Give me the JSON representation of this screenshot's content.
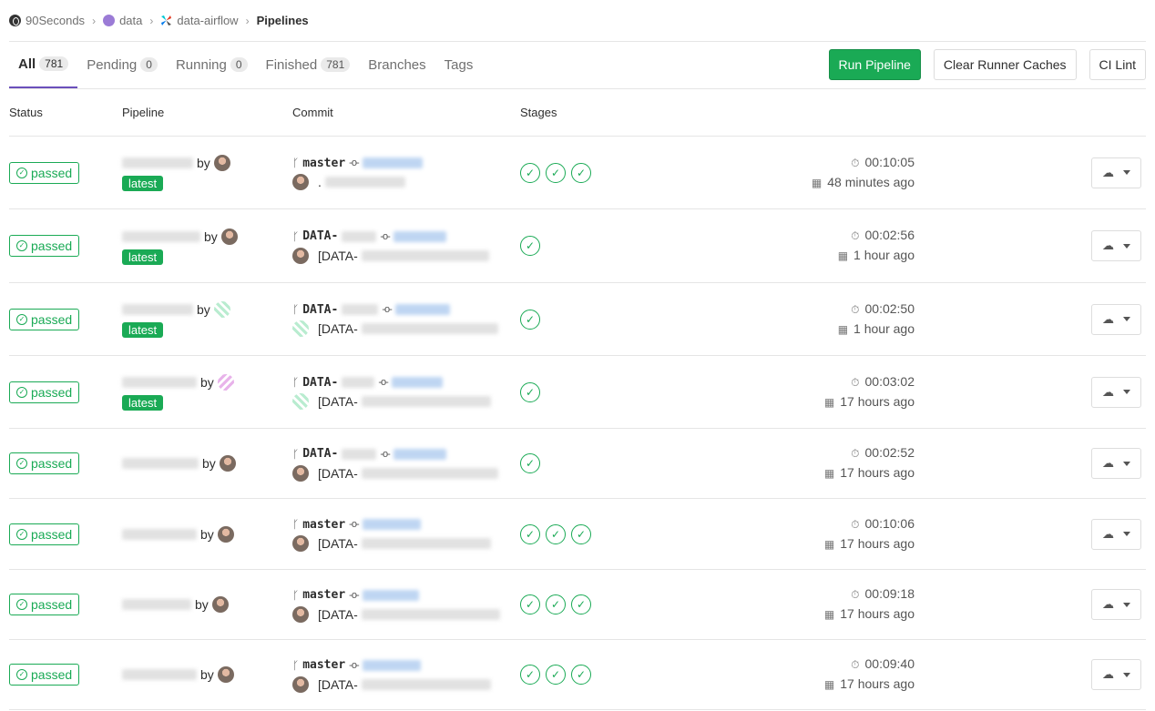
{
  "breadcrumb": {
    "org": "90Seconds",
    "group": "data",
    "project": "data-airflow",
    "current": "Pipelines"
  },
  "tabs": [
    {
      "label": "All",
      "count": "781",
      "active": true
    },
    {
      "label": "Pending",
      "count": "0"
    },
    {
      "label": "Running",
      "count": "0"
    },
    {
      "label": "Finished",
      "count": "781"
    },
    {
      "label": "Branches"
    },
    {
      "label": "Tags"
    }
  ],
  "actions": {
    "run_pipeline": "Run Pipeline",
    "clear_caches": "Clear Runner Caches",
    "ci_lint": "CI Lint"
  },
  "table_headers": {
    "status": "Status",
    "pipeline": "Pipeline",
    "commit": "Commit",
    "stages": "Stages"
  },
  "colors": {
    "success": "#1aaa55",
    "tab_active": "#6b4fbb"
  },
  "icons": {
    "status": "check-circle-icon",
    "duration": "timer-icon",
    "finished": "calendar-icon",
    "download": "cloud-download-icon",
    "branch": "branch-icon",
    "commit": "commit-icon"
  },
  "rows": [
    {
      "status": "passed",
      "by": "by",
      "latest": "latest",
      "ref": "master",
      "message": ".",
      "stages": 3,
      "duration": "00:10:05",
      "finished": "48 minutes ago",
      "avatar": "photo",
      "commit_avatar": "photo"
    },
    {
      "status": "passed",
      "by": "by",
      "latest": "latest",
      "ref": "DATA-",
      "message": "[DATA-",
      "stages": 1,
      "duration": "00:02:56",
      "finished": "1 hour ago",
      "avatar": "photo",
      "commit_avatar": "photo"
    },
    {
      "status": "passed",
      "by": "by",
      "latest": "latest",
      "ref": "DATA-",
      "message": "[DATA-",
      "stages": 1,
      "duration": "00:02:50",
      "finished": "1 hour ago",
      "avatar": "green",
      "commit_avatar": "green"
    },
    {
      "status": "passed",
      "by": "by",
      "latest": "latest",
      "ref": "DATA-",
      "message": "[DATA-",
      "stages": 1,
      "duration": "00:03:02",
      "finished": "17 hours ago",
      "avatar": "pink",
      "commit_avatar": "green"
    },
    {
      "status": "passed",
      "by": "by",
      "latest": "",
      "ref": "DATA-",
      "message": "[DATA-",
      "stages": 1,
      "duration": "00:02:52",
      "finished": "17 hours ago",
      "avatar": "photo",
      "commit_avatar": "photo"
    },
    {
      "status": "passed",
      "by": "by",
      "latest": "",
      "ref": "master",
      "message": "[DATA-",
      "stages": 3,
      "duration": "00:10:06",
      "finished": "17 hours ago",
      "avatar": "photo",
      "commit_avatar": "photo"
    },
    {
      "status": "passed",
      "by": "by",
      "latest": "",
      "ref": "master",
      "message": "[DATA-",
      "stages": 3,
      "duration": "00:09:18",
      "finished": "17 hours ago",
      "avatar": "photo",
      "commit_avatar": "photo"
    },
    {
      "status": "passed",
      "by": "by",
      "latest": "",
      "ref": "master",
      "message": "[DATA-",
      "stages": 3,
      "duration": "00:09:40",
      "finished": "17 hours ago",
      "avatar": "photo",
      "commit_avatar": "photo"
    }
  ]
}
